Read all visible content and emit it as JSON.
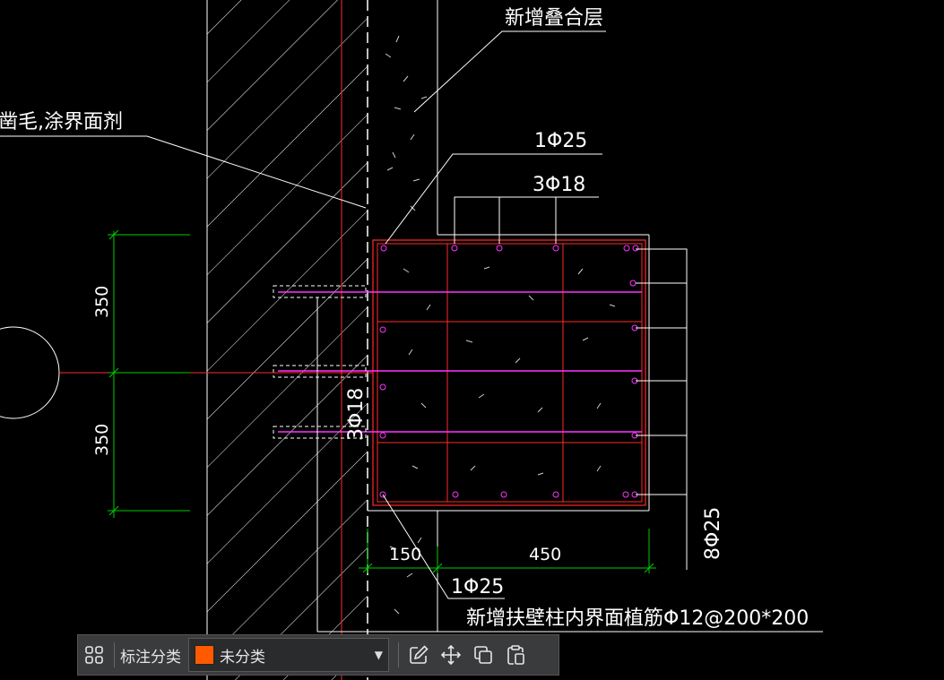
{
  "annotations": {
    "overlay_layer": "新增叠合层",
    "roughen_note": "凿毛,涂界面剂",
    "corner_bar_top": "1Φ25",
    "top_bars": "3Φ18",
    "side_bars": "8Φ25",
    "anchor_bars": "3Φ18",
    "corner_bar_bottom": "1Φ25",
    "planted_bars": "新增扶壁柱内界面植筋Φ12@200*200"
  },
  "dimensions": {
    "upper": "350",
    "lower": "350",
    "left_width": "150",
    "right_width": "450"
  },
  "colors": {
    "background": "#000000",
    "lines": "#ffffff",
    "rebar": "#ff2a2a",
    "stirrup": "#ff33ff",
    "dimension": "#00cc00",
    "category": "#ff5a00"
  },
  "toolbar": {
    "grid_icon": "grid-icon",
    "category_label": "标注分类",
    "category_value": "未分类",
    "edit_icon": "edit-icon",
    "move_icon": "move-icon",
    "copy_icon": "copy-icon",
    "paste_icon": "paste-icon"
  }
}
